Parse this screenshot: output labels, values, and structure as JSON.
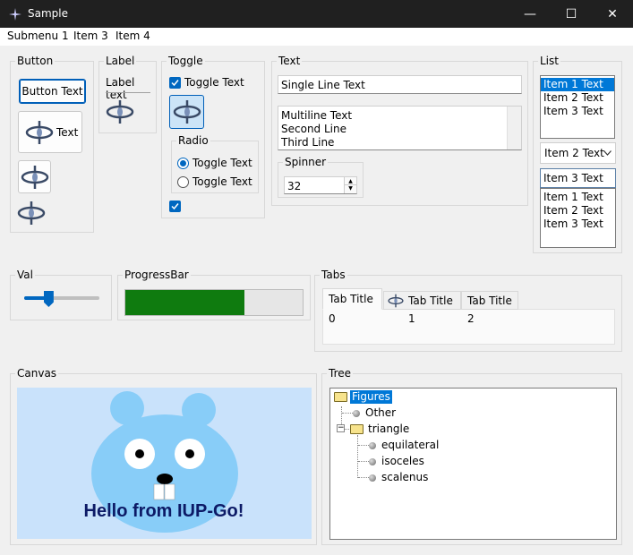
{
  "window": {
    "title": "Sample",
    "minimize": "—",
    "maximize": "☐",
    "close": "✕"
  },
  "menu": {
    "items": [
      "Submenu 1",
      "Item 3",
      "Item 4"
    ]
  },
  "button_group": {
    "title": "Button",
    "button_text": "Button Text",
    "icon_text_button": "Text"
  },
  "label_group": {
    "title": "Label",
    "label_text": "Label text"
  },
  "toggle_group": {
    "title": "Toggle",
    "toggle_text": "Toggle Text",
    "toggle_checked": true,
    "radio_title": "Radio",
    "radio1": "Toggle Text",
    "radio2": "Toggle Text"
  },
  "text_group": {
    "title": "Text",
    "single_line": "Single Line Text",
    "multiline": [
      "Multiline Text",
      "Second Line",
      "Third Line"
    ],
    "spinner_title": "Spinner",
    "spinner_value": "32"
  },
  "list_group": {
    "title": "List",
    "list1": [
      "Item 1 Text",
      "Item 2 Text",
      "Item 3 Text"
    ],
    "dropdown_value": "Item 2 Text",
    "edit_value": "Item 3 Text",
    "list2": [
      "Item 1 Text",
      "Item 2 Text",
      "Item 3 Text"
    ]
  },
  "val_group": {
    "title": "Val",
    "value_fraction": 0.32
  },
  "progress_group": {
    "title": "ProgressBar",
    "value_fraction": 0.67
  },
  "tabs_group": {
    "title": "Tabs",
    "tabs": [
      "Tab Title 0",
      "Tab Title 1",
      "Tab Title 2"
    ]
  },
  "canvas_group": {
    "title": "Canvas",
    "text": "Hello from IUP-Go!"
  },
  "tree_group": {
    "title": "Tree",
    "root": "Figures",
    "other": "Other",
    "triangle": "triangle",
    "leaves": [
      "equilateral",
      "isoceles",
      "scalenus"
    ]
  },
  "colors": {
    "selection": "#0078d7",
    "progress": "#0f7b0f",
    "canvas_bg": "#c9e2fb",
    "gopher": "#88cdf8"
  }
}
